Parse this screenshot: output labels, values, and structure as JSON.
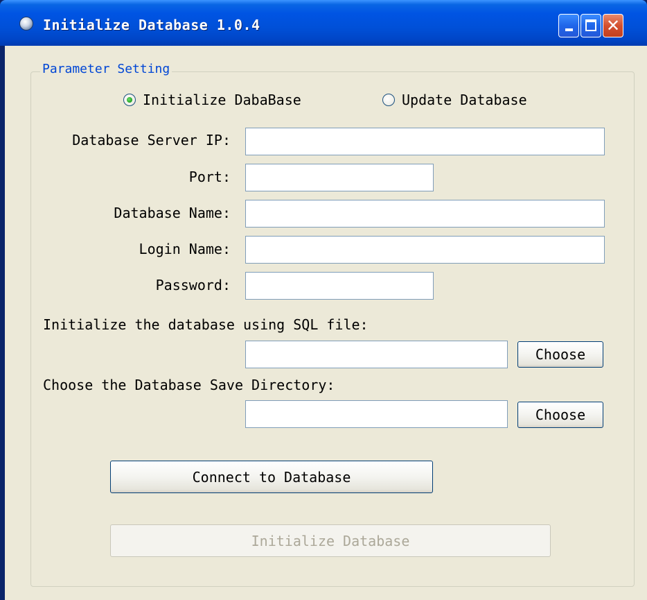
{
  "window": {
    "title": "Initialize Database 1.0.4",
    "controls": {
      "minimize": "minimize-icon",
      "maximize": "maximize-icon",
      "close": "close-icon"
    }
  },
  "group": {
    "title": "Parameter Setting"
  },
  "mode": {
    "options": [
      {
        "label": "Initialize DabaBase",
        "checked": true
      },
      {
        "label": "Update Database",
        "checked": false
      }
    ]
  },
  "fields": {
    "server_ip": {
      "label": "Database Server IP:",
      "value": ""
    },
    "port": {
      "label": "Port:",
      "value": ""
    },
    "db_name": {
      "label": "Database Name:",
      "value": ""
    },
    "login_name": {
      "label": "Login Name:",
      "value": ""
    },
    "password": {
      "label": "Password:",
      "value": ""
    }
  },
  "sql_file": {
    "label": "Initialize the database using SQL file:",
    "value": "",
    "button": "Choose"
  },
  "save_dir": {
    "label": "Choose the Database Save Directory:",
    "value": "",
    "button": "Choose"
  },
  "actions": {
    "connect": "Connect to Database",
    "initialize": "Initialize Database",
    "initialize_enabled": false
  },
  "colors": {
    "title_bar": "#0054e3",
    "client_bg": "#ece9d8",
    "group_title": "#0046d5",
    "close_button": "#d4502e"
  }
}
